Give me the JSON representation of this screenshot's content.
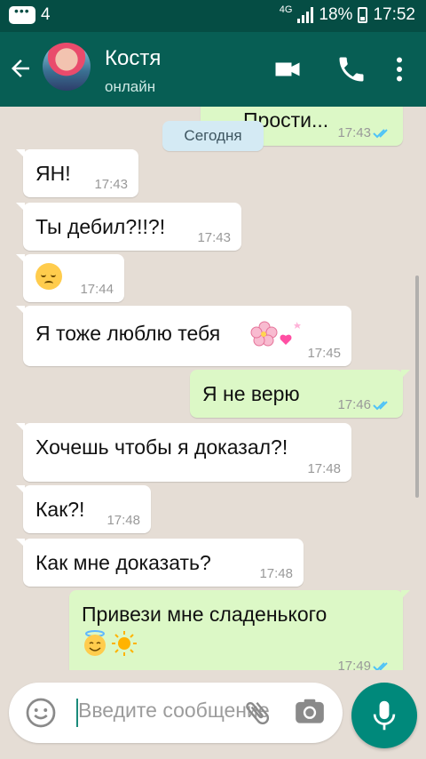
{
  "status_bar": {
    "notification_count": "4",
    "network": "4G",
    "battery": "18%",
    "time": "17:52"
  },
  "header": {
    "contact_name": "Костя",
    "contact_status": "онлайн",
    "icons": [
      "back-arrow-icon",
      "video-call-icon",
      "phone-icon",
      "more-vert-icon"
    ]
  },
  "chat": {
    "partial_message": {
      "text": "Прости...",
      "time": "17:43"
    },
    "date_chip": "Сегодня",
    "messages": [
      {
        "dir": "in",
        "text": "ЯН!",
        "time": "17:43"
      },
      {
        "dir": "in",
        "text": "Ты дебил?!!?!",
        "time": "17:43"
      },
      {
        "dir": "in",
        "text": "",
        "emoji": "pensive-face",
        "time": "17:44"
      },
      {
        "dir": "in",
        "text": "Я тоже люблю тебя",
        "emoji": "cherry-blossom, sparkling-heart",
        "time": "17:45"
      },
      {
        "dir": "out",
        "text": "Я не верю",
        "time": "17:46"
      },
      {
        "dir": "in",
        "text": "Хочешь чтобы я доказал?!",
        "time": "17:48"
      },
      {
        "dir": "in",
        "text": "Как?!",
        "time": "17:48"
      },
      {
        "dir": "in",
        "text": "Как мне доказать?",
        "time": "17:48"
      },
      {
        "dir": "out",
        "text": "Привези мне сладенького",
        "emoji": "smiling-face-with-halo, sun",
        "time": "17:49"
      }
    ]
  },
  "input": {
    "placeholder": "Введите сообщение",
    "icons": [
      "emoji-icon",
      "attach-icon",
      "camera-icon",
      "mic-icon"
    ]
  },
  "colors": {
    "status_bar": "#054d44",
    "app_bar": "#075e54",
    "chat_bg": "#e5ddd5",
    "incoming": "#ffffff",
    "outgoing": "#dcf8c6",
    "read_ticks": "#4fc3f7",
    "accent": "#00897b"
  }
}
